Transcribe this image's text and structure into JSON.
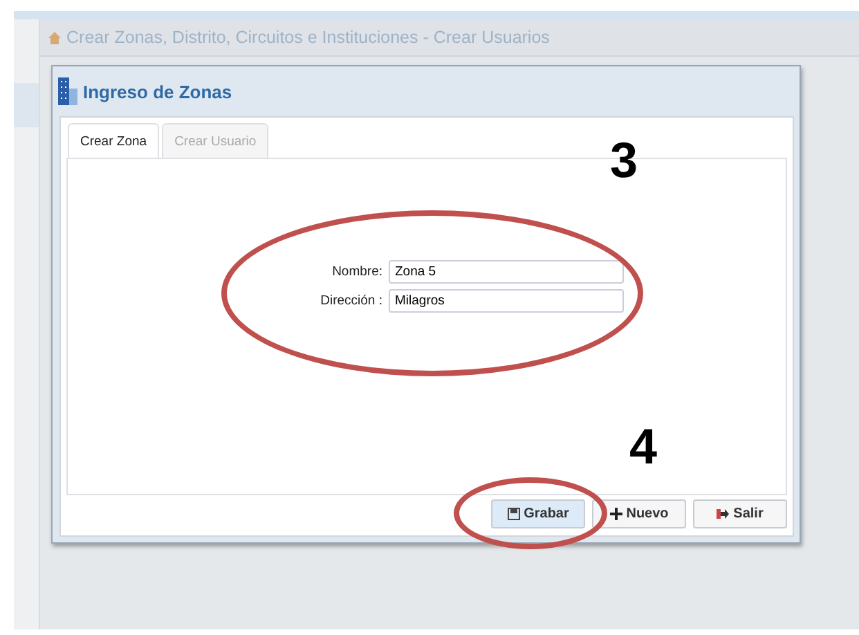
{
  "page_title": "Crear Zonas, Distrito, Circuitos e Instituciones - Crear Usuarios",
  "dialog": {
    "title": "Ingreso de Zonas",
    "tabs": [
      {
        "label": "Crear Zona",
        "selected": true
      },
      {
        "label": "Crear Usuario",
        "selected": false
      }
    ],
    "fields": [
      {
        "label": "Nombre:",
        "value": "Zona 5"
      },
      {
        "label": "Dirección :",
        "value": "Milagros"
      }
    ],
    "buttons": [
      {
        "kind": "save",
        "label": "Grabar",
        "selected": true
      },
      {
        "kind": "new",
        "label": "Nuevo",
        "selected": false
      },
      {
        "kind": "exit",
        "label": "Salir",
        "selected": false
      }
    ]
  },
  "annotations": [
    {
      "kind": "fields",
      "label": "3"
    },
    {
      "kind": "save",
      "label": "4"
    }
  ]
}
